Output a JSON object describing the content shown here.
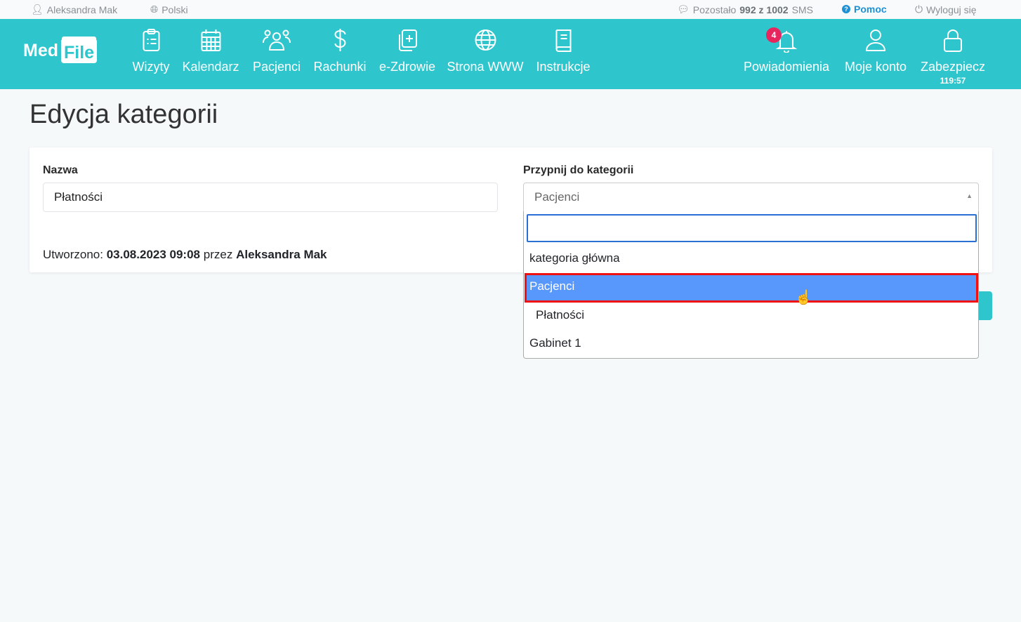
{
  "topbar": {
    "user": "Aleksandra Mak",
    "language": "Polski",
    "sms_prefix": "Pozostało",
    "sms_left": "992 z 1002",
    "sms_suffix": "SMS",
    "help": "Pomoc",
    "logout": "Wyloguj się"
  },
  "logo": {
    "part1": "Med",
    "part2": "File"
  },
  "nav": {
    "items": [
      {
        "label": "Wizyty",
        "icon": "clipboard-list-icon"
      },
      {
        "label": "Kalendarz",
        "icon": "calendar-icon"
      },
      {
        "label": "Pacjenci",
        "icon": "users-icon"
      },
      {
        "label": "Rachunki",
        "icon": "dollar-icon"
      },
      {
        "label": "e-Zdrowie",
        "icon": "medical-file-icon"
      },
      {
        "label": "Strona WWW",
        "icon": "globe-icon"
      },
      {
        "label": "Instrukcje",
        "icon": "book-icon"
      }
    ],
    "right": {
      "notifications": "Powiadomienia",
      "notifications_count": "4",
      "account": "Moje konto",
      "lock": "Zabezpiecz",
      "timer": "119:57"
    }
  },
  "page": {
    "title": "Edycja kategorii"
  },
  "form": {
    "name_label": "Nazwa",
    "name_value": "Płatności",
    "parent_label": "Przypnij do kategorii",
    "parent_value": "Pacjenci",
    "created_label": "Utworzono:",
    "created_date": "03.08.2023 09:08",
    "created_by_label": "przez",
    "created_by": "Aleksandra Mak"
  },
  "dropdown": {
    "search_value": "",
    "options": [
      "kategoria główna",
      "Pacjenci",
      "Płatności",
      "Gabinet 1"
    ],
    "highlighted": "Pacjenci"
  },
  "colors": {
    "brand": "#2fc5cc",
    "highlight": "#5897fb",
    "badge": "#e8265e"
  }
}
